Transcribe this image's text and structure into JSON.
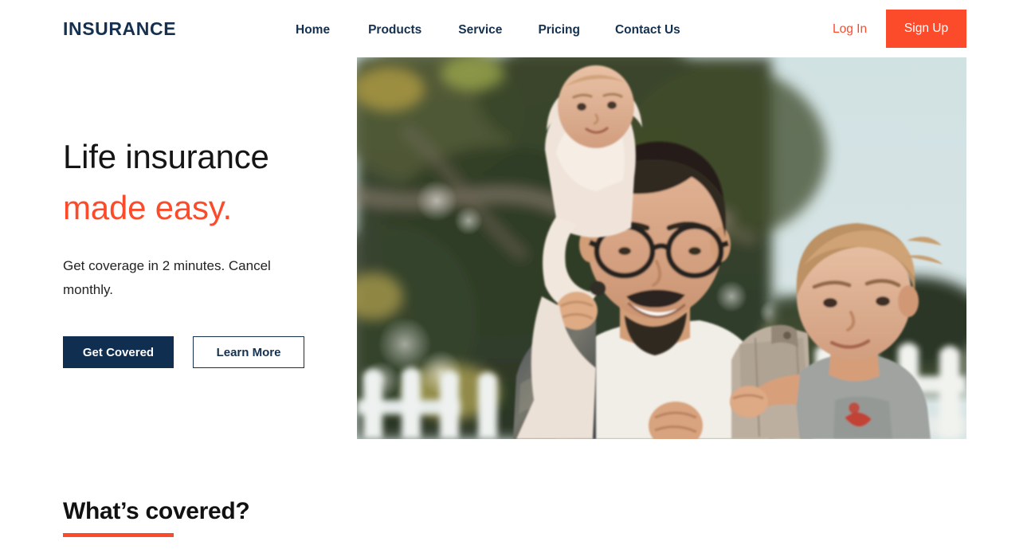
{
  "header": {
    "logo": "INSURANCE",
    "nav": [
      {
        "label": "Home"
      },
      {
        "label": "Products"
      },
      {
        "label": "Service"
      },
      {
        "label": "Pricing"
      },
      {
        "label": "Contact Us"
      }
    ],
    "login_label": "Log In",
    "signup_label": "Sign Up"
  },
  "hero": {
    "title_line1": "Life insurance",
    "title_line2": "made easy.",
    "subtitle": "Get coverage in 2 minutes. Cancel monthly.",
    "primary_cta": "Get Covered",
    "secondary_cta": "Learn More",
    "image_alt": "Smiling father with glasses carrying a toddler on his shoulders and holding a young child, in front of a white picket fence and blurred green garden"
  },
  "section": {
    "heading": "What’s covered?"
  },
  "colors": {
    "accent_orange": "#FB4B2B",
    "navy": "#0F2E50",
    "logo_navy": "#15314F",
    "text_dark": "#151515",
    "background": "#FFFFFF"
  }
}
